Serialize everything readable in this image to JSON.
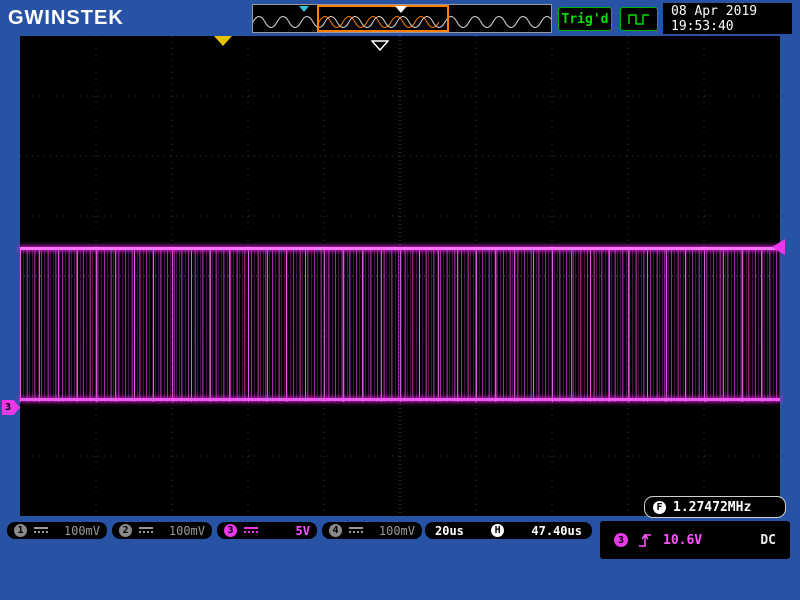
{
  "brand": "GWINSTEK",
  "top_bar": {
    "trig_status": "Trig'd",
    "date": "08 Apr 2019",
    "time": "19:53:40"
  },
  "display": {
    "frequency_label": "F",
    "frequency": "1.27472MHz",
    "ground_tag_channel": "3"
  },
  "channels": [
    {
      "id": "1",
      "scale": "100mV",
      "active": false
    },
    {
      "id": "2",
      "scale": "100mV",
      "active": false
    },
    {
      "id": "3",
      "scale": "5V",
      "active": true
    },
    {
      "id": "4",
      "scale": "100mV",
      "active": false
    }
  ],
  "horizontal": {
    "scale": "20us",
    "label": "H",
    "position": "47.40us"
  },
  "trigger": {
    "source": "3",
    "slope": "rising-edge",
    "level": "10.6V",
    "coupling": "DC"
  },
  "colors": {
    "background_blue": "#2852a3",
    "accent_magenta": "#e838e8",
    "trig_green": "#00e000",
    "window_orange": "#ff8000"
  }
}
